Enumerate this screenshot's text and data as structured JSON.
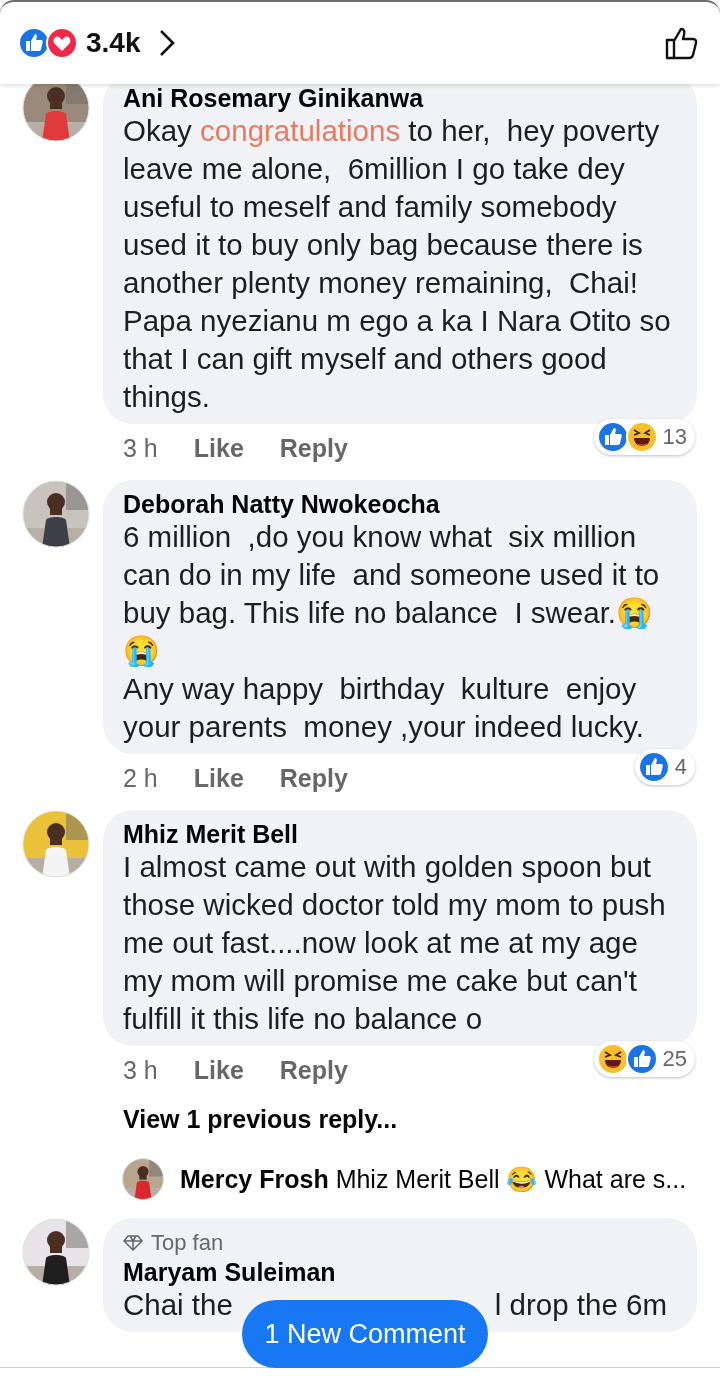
{
  "header": {
    "reactions": [
      {
        "kind": "like"
      },
      {
        "kind": "love"
      }
    ],
    "count": "3.4k"
  },
  "comments": [
    {
      "author": "Ani Rosemary Ginikanwa",
      "text": "Okay **congratulations** to her,  hey poverty leave me alone,  6million I go take dey useful to meself and family somebody used it to buy only bag because there is another plenty money remaining,  Chai! Papa nyezianu m ego a ka I Nara Otito so that I can gift myself and others good things.",
      "time": "3 h",
      "like": "Like",
      "reply": "Reply",
      "reactions": [
        {
          "kind": "like"
        },
        {
          "kind": "haha"
        }
      ],
      "reaction_count": "13"
    },
    {
      "author": "Deborah Natty Nwokeocha",
      "text": "6 million  ,do you know what  six million can do in my life  and someone used it to buy bag. This life no balance  I swear.😭😭\nAny way happy  birthday  kulture  enjoy your parents  money ,your indeed lucky.",
      "time": "2 h",
      "like": "Like",
      "reply": "Reply",
      "reactions": [
        {
          "kind": "like"
        }
      ],
      "reaction_count": "4"
    },
    {
      "author": "Mhiz Merit Bell",
      "text": "I almost came out with golden spoon but those wicked doctor told my mom to push me out fast....now look at me at my age my mom will promise me cake but can't fulfill it this life no balance o",
      "time": "3 h",
      "like": "Like",
      "reply": "Reply",
      "reactions": [
        {
          "kind": "haha"
        },
        {
          "kind": "like"
        }
      ],
      "reaction_count": "25",
      "view_replies": "View 1 previous reply...",
      "replies": [
        {
          "author": "Mercy Frosh",
          "text": "Mhiz Merit Bell 😂 What are s..."
        }
      ]
    },
    {
      "author": "Maryam Suleiman",
      "badge": "Top fan",
      "fragments": [
        [
          "Chai the",
          "l drop the 6m"
        ]
      ]
    }
  ],
  "new_comments": "1 New Comment"
}
